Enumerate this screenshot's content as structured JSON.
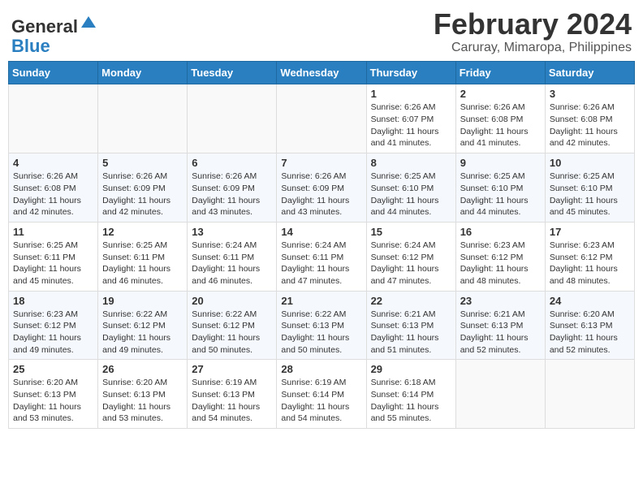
{
  "header": {
    "logo_line1": "General",
    "logo_line2": "Blue",
    "title": "February 2024",
    "subtitle": "Caruray, Mimaropa, Philippines"
  },
  "weekdays": [
    "Sunday",
    "Monday",
    "Tuesday",
    "Wednesday",
    "Thursday",
    "Friday",
    "Saturday"
  ],
  "weeks": [
    [
      {
        "day": "",
        "info": ""
      },
      {
        "day": "",
        "info": ""
      },
      {
        "day": "",
        "info": ""
      },
      {
        "day": "",
        "info": ""
      },
      {
        "day": "1",
        "info": "Sunrise: 6:26 AM\nSunset: 6:07 PM\nDaylight: 11 hours\nand 41 minutes."
      },
      {
        "day": "2",
        "info": "Sunrise: 6:26 AM\nSunset: 6:08 PM\nDaylight: 11 hours\nand 41 minutes."
      },
      {
        "day": "3",
        "info": "Sunrise: 6:26 AM\nSunset: 6:08 PM\nDaylight: 11 hours\nand 42 minutes."
      }
    ],
    [
      {
        "day": "4",
        "info": "Sunrise: 6:26 AM\nSunset: 6:08 PM\nDaylight: 11 hours\nand 42 minutes."
      },
      {
        "day": "5",
        "info": "Sunrise: 6:26 AM\nSunset: 6:09 PM\nDaylight: 11 hours\nand 42 minutes."
      },
      {
        "day": "6",
        "info": "Sunrise: 6:26 AM\nSunset: 6:09 PM\nDaylight: 11 hours\nand 43 minutes."
      },
      {
        "day": "7",
        "info": "Sunrise: 6:26 AM\nSunset: 6:09 PM\nDaylight: 11 hours\nand 43 minutes."
      },
      {
        "day": "8",
        "info": "Sunrise: 6:25 AM\nSunset: 6:10 PM\nDaylight: 11 hours\nand 44 minutes."
      },
      {
        "day": "9",
        "info": "Sunrise: 6:25 AM\nSunset: 6:10 PM\nDaylight: 11 hours\nand 44 minutes."
      },
      {
        "day": "10",
        "info": "Sunrise: 6:25 AM\nSunset: 6:10 PM\nDaylight: 11 hours\nand 45 minutes."
      }
    ],
    [
      {
        "day": "11",
        "info": "Sunrise: 6:25 AM\nSunset: 6:11 PM\nDaylight: 11 hours\nand 45 minutes."
      },
      {
        "day": "12",
        "info": "Sunrise: 6:25 AM\nSunset: 6:11 PM\nDaylight: 11 hours\nand 46 minutes."
      },
      {
        "day": "13",
        "info": "Sunrise: 6:24 AM\nSunset: 6:11 PM\nDaylight: 11 hours\nand 46 minutes."
      },
      {
        "day": "14",
        "info": "Sunrise: 6:24 AM\nSunset: 6:11 PM\nDaylight: 11 hours\nand 47 minutes."
      },
      {
        "day": "15",
        "info": "Sunrise: 6:24 AM\nSunset: 6:12 PM\nDaylight: 11 hours\nand 47 minutes."
      },
      {
        "day": "16",
        "info": "Sunrise: 6:23 AM\nSunset: 6:12 PM\nDaylight: 11 hours\nand 48 minutes."
      },
      {
        "day": "17",
        "info": "Sunrise: 6:23 AM\nSunset: 6:12 PM\nDaylight: 11 hours\nand 48 minutes."
      }
    ],
    [
      {
        "day": "18",
        "info": "Sunrise: 6:23 AM\nSunset: 6:12 PM\nDaylight: 11 hours\nand 49 minutes."
      },
      {
        "day": "19",
        "info": "Sunrise: 6:22 AM\nSunset: 6:12 PM\nDaylight: 11 hours\nand 49 minutes."
      },
      {
        "day": "20",
        "info": "Sunrise: 6:22 AM\nSunset: 6:12 PM\nDaylight: 11 hours\nand 50 minutes."
      },
      {
        "day": "21",
        "info": "Sunrise: 6:22 AM\nSunset: 6:13 PM\nDaylight: 11 hours\nand 50 minutes."
      },
      {
        "day": "22",
        "info": "Sunrise: 6:21 AM\nSunset: 6:13 PM\nDaylight: 11 hours\nand 51 minutes."
      },
      {
        "day": "23",
        "info": "Sunrise: 6:21 AM\nSunset: 6:13 PM\nDaylight: 11 hours\nand 52 minutes."
      },
      {
        "day": "24",
        "info": "Sunrise: 6:20 AM\nSunset: 6:13 PM\nDaylight: 11 hours\nand 52 minutes."
      }
    ],
    [
      {
        "day": "25",
        "info": "Sunrise: 6:20 AM\nSunset: 6:13 PM\nDaylight: 11 hours\nand 53 minutes."
      },
      {
        "day": "26",
        "info": "Sunrise: 6:20 AM\nSunset: 6:13 PM\nDaylight: 11 hours\nand 53 minutes."
      },
      {
        "day": "27",
        "info": "Sunrise: 6:19 AM\nSunset: 6:13 PM\nDaylight: 11 hours\nand 54 minutes."
      },
      {
        "day": "28",
        "info": "Sunrise: 6:19 AM\nSunset: 6:14 PM\nDaylight: 11 hours\nand 54 minutes."
      },
      {
        "day": "29",
        "info": "Sunrise: 6:18 AM\nSunset: 6:14 PM\nDaylight: 11 hours\nand 55 minutes."
      },
      {
        "day": "",
        "info": ""
      },
      {
        "day": "",
        "info": ""
      }
    ]
  ]
}
